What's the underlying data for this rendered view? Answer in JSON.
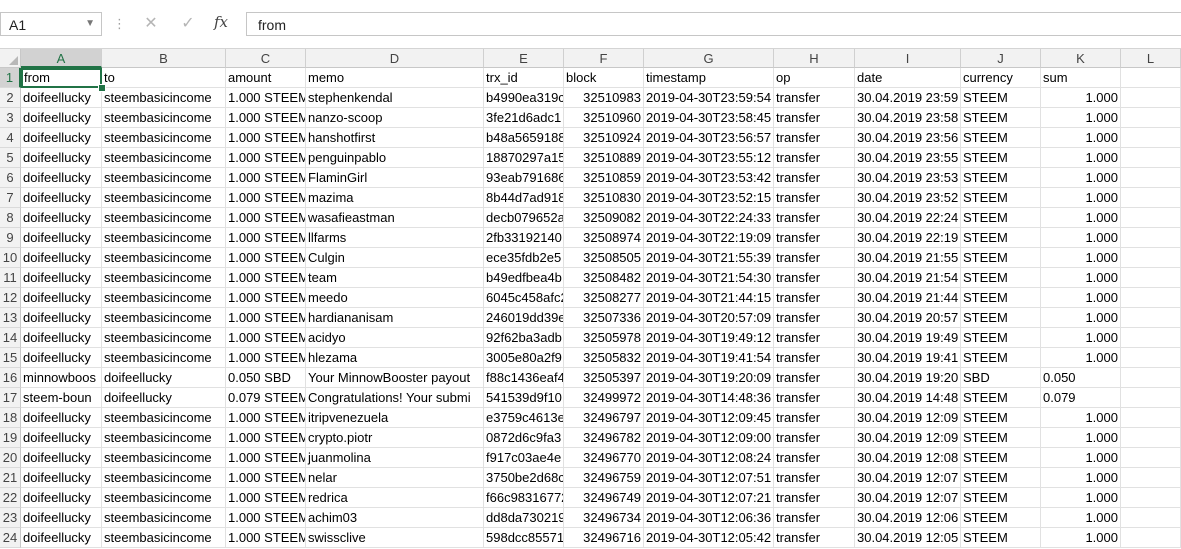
{
  "name_box": {
    "value": "A1"
  },
  "formula_bar": {
    "value": "from",
    "fx_label": "fx"
  },
  "columns": [
    "A",
    "B",
    "C",
    "D",
    "E",
    "F",
    "G",
    "H",
    "I",
    "J",
    "K",
    "L"
  ],
  "rows": [
    [
      "from",
      "to",
      "amount",
      "memo",
      "trx_id",
      "block",
      "timestamp",
      "op",
      "date",
      "currency",
      "sum"
    ],
    [
      "doifeellucky",
      "steembasicincome",
      "1.000 STEEM",
      "stephenkendal",
      "b4990ea319c",
      "32510983",
      "2019-04-30T23:59:54",
      "transfer",
      "30.04.2019 23:59",
      "STEEM",
      "1.000"
    ],
    [
      "doifeellucky",
      "steembasicincome",
      "1.000 STEEM",
      "nanzo-scoop",
      "3fe21d6adc1",
      "32510960",
      "2019-04-30T23:58:45",
      "transfer",
      "30.04.2019 23:58",
      "STEEM",
      "1.000"
    ],
    [
      "doifeellucky",
      "steembasicincome",
      "1.000 STEEM",
      "hanshotfirst",
      "b48a5659188",
      "32510924",
      "2019-04-30T23:56:57",
      "transfer",
      "30.04.2019 23:56",
      "STEEM",
      "1.000"
    ],
    [
      "doifeellucky",
      "steembasicincome",
      "1.000 STEEM",
      "penguinpablo",
      "18870297a15",
      "32510889",
      "2019-04-30T23:55:12",
      "transfer",
      "30.04.2019 23:55",
      "STEEM",
      "1.000"
    ],
    [
      "doifeellucky",
      "steembasicincome",
      "1.000 STEEM",
      "FlaminGirl",
      "93eab791686",
      "32510859",
      "2019-04-30T23:53:42",
      "transfer",
      "30.04.2019 23:53",
      "STEEM",
      "1.000"
    ],
    [
      "doifeellucky",
      "steembasicincome",
      "1.000 STEEM",
      "mazima",
      "8b44d7ad918",
      "32510830",
      "2019-04-30T23:52:15",
      "transfer",
      "30.04.2019 23:52",
      "STEEM",
      "1.000"
    ],
    [
      "doifeellucky",
      "steembasicincome",
      "1.000 STEEM",
      "wasafieastman",
      "decb079652a",
      "32509082",
      "2019-04-30T22:24:33",
      "transfer",
      "30.04.2019 22:24",
      "STEEM",
      "1.000"
    ],
    [
      "doifeellucky",
      "steembasicincome",
      "1.000 STEEM",
      " llfarms",
      "2fb33192140",
      "32508974",
      "2019-04-30T22:19:09",
      "transfer",
      "30.04.2019 22:19",
      "STEEM",
      "1.000"
    ],
    [
      "doifeellucky",
      "steembasicincome",
      "1.000 STEEM",
      "Culgin",
      "ece35fdb2e5",
      "32508505",
      "2019-04-30T21:55:39",
      "transfer",
      "30.04.2019 21:55",
      "STEEM",
      "1.000"
    ],
    [
      "doifeellucky",
      "steembasicincome",
      "1.000 STEEM",
      "team",
      "b49edfbea4b",
      "32508482",
      "2019-04-30T21:54:30",
      "transfer",
      "30.04.2019 21:54",
      "STEEM",
      "1.000"
    ],
    [
      "doifeellucky",
      "steembasicincome",
      "1.000 STEEM",
      "meedo",
      "6045c458afc2",
      "32508277",
      "2019-04-30T21:44:15",
      "transfer",
      "30.04.2019 21:44",
      "STEEM",
      "1.000"
    ],
    [
      "doifeellucky",
      "steembasicincome",
      "1.000 STEEM",
      "hardiananisam",
      "246019dd39e",
      "32507336",
      "2019-04-30T20:57:09",
      "transfer",
      "30.04.2019 20:57",
      "STEEM",
      "1.000"
    ],
    [
      "doifeellucky",
      "steembasicincome",
      "1.000 STEEM",
      "acidyo",
      "92f62ba3adb",
      "32505978",
      "2019-04-30T19:49:12",
      "transfer",
      "30.04.2019 19:49",
      "STEEM",
      "1.000"
    ],
    [
      "doifeellucky",
      "steembasicincome",
      "1.000 STEEM",
      "hlezama",
      "3005e80a2f9",
      "32505832",
      "2019-04-30T19:41:54",
      "transfer",
      "30.04.2019 19:41",
      "STEEM",
      "1.000"
    ],
    [
      "minnowboos",
      "doifeellucky",
      "0.050 SBD",
      "Your MinnowBooster payout",
      "f88c1436eaf4",
      "32505397",
      "2019-04-30T19:20:09",
      "transfer",
      "30.04.2019 19:20",
      "SBD",
      "0.050"
    ],
    [
      "steem-boun",
      "doifeellucky",
      "0.079 STEEM",
      "Congratulations! Your submi",
      "541539d9f10",
      "32499972",
      "2019-04-30T14:48:36",
      "transfer",
      "30.04.2019 14:48",
      "STEEM",
      "0.079"
    ],
    [
      "doifeellucky",
      "steembasicincome",
      "1.000 STEEM",
      "itripvenezuela",
      "e3759c4613e",
      "32496797",
      "2019-04-30T12:09:45",
      "transfer",
      "30.04.2019 12:09",
      "STEEM",
      "1.000"
    ],
    [
      "doifeellucky",
      "steembasicincome",
      "1.000 STEEM",
      "crypto.piotr",
      "0872d6c9fa3",
      "32496782",
      "2019-04-30T12:09:00",
      "transfer",
      "30.04.2019 12:09",
      "STEEM",
      "1.000"
    ],
    [
      "doifeellucky",
      "steembasicincome",
      "1.000 STEEM",
      "juanmolina",
      "f917c03ae4e",
      "32496770",
      "2019-04-30T12:08:24",
      "transfer",
      "30.04.2019 12:08",
      "STEEM",
      "1.000"
    ],
    [
      "doifeellucky",
      "steembasicincome",
      "1.000 STEEM",
      "nelar",
      "3750be2d68c",
      "32496759",
      "2019-04-30T12:07:51",
      "transfer",
      "30.04.2019 12:07",
      "STEEM",
      "1.000"
    ],
    [
      "doifeellucky",
      "steembasicincome",
      "1.000 STEEM",
      "redrica",
      "f66c98316772",
      "32496749",
      "2019-04-30T12:07:21",
      "transfer",
      "30.04.2019 12:07",
      "STEEM",
      "1.000"
    ],
    [
      "doifeellucky",
      "steembasicincome",
      "1.000 STEEM",
      "achim03",
      "dd8da730219",
      "32496734",
      "2019-04-30T12:06:36",
      "transfer",
      "30.04.2019 12:06",
      "STEEM",
      "1.000"
    ],
    [
      "doifeellucky",
      "steembasicincome",
      "1.000 STEEM",
      "swissclive",
      "598dcc85571",
      "32496716",
      "2019-04-30T12:05:42",
      "transfer",
      "30.04.2019 12:05",
      "STEEM",
      "1.000"
    ]
  ]
}
